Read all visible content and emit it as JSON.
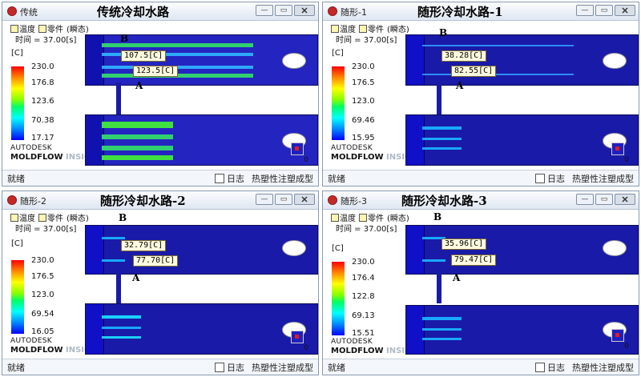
{
  "windows": [
    {
      "name": "传统",
      "heading": "传统冷却水路",
      "toolbar": {
        "item1": "温度",
        "item2": "零件",
        "mode": "(瞬态)"
      },
      "time_label": "时间 = 37.00[s]",
      "unit": "[C]",
      "legend": [
        "230.0",
        "176.8",
        "123.6",
        "70.38",
        "17.17"
      ],
      "probes": [
        "107.5[C]",
        "123.5[C]"
      ],
      "marker_b": "B",
      "marker_a": "A",
      "brand1": "AUTODESK",
      "brand2_main": "MOLDFLOW",
      "brand2_suffix": "INSIGHT",
      "axis_zero": "0",
      "status_ready": "就绪",
      "status_log": "日志",
      "status_mode": "热塑性注塑成型"
    },
    {
      "name": "随形-1",
      "heading": "随形冷却水路-1",
      "toolbar": {
        "item1": "温度",
        "item2": "零件",
        "mode": "(瞬态)"
      },
      "time_label": "时间 = 37.00[s]",
      "unit": "[C]",
      "legend": [
        "230.0",
        "176.5",
        "123.0",
        "69.46",
        "15.95"
      ],
      "probes": [
        "38.28[C]",
        "82.55[C]"
      ],
      "marker_b": "B",
      "marker_a": "A",
      "brand1": "AUTODESK",
      "brand2_main": "MOLDFLOW",
      "brand2_suffix": "INSIGHT",
      "axis_zero": "0",
      "status_ready": "就绪",
      "status_log": "日志",
      "status_mode": "热塑性注塑成型"
    },
    {
      "name": "随形-2",
      "heading": "随形冷却水路-2",
      "toolbar": {
        "item1": "温度",
        "item2": "零件",
        "mode": "(瞬态)"
      },
      "time_label": "时间 = 37.00[s]",
      "unit": "[C]",
      "legend": [
        "230.0",
        "176.5",
        "123.0",
        "69.54",
        "16.05"
      ],
      "probes": [
        "32.79[C]",
        "77.70[C]"
      ],
      "marker_b": "B",
      "marker_a": "A",
      "brand1": "AUTODESK",
      "brand2_main": "MOLDFLOW",
      "brand2_suffix": "INSIGHT",
      "axis_zero": "0",
      "status_ready": "就绪",
      "status_log": "日志",
      "status_mode": "热塑性注塑成型"
    },
    {
      "name": "随形-3",
      "heading": "随形冷却水路-3",
      "toolbar": {
        "item1": "温度",
        "item2": "零件",
        "mode": "(瞬态)"
      },
      "time_label": "时间 = 37.00[s]",
      "unit": "[C]",
      "legend": [
        "230.0",
        "176.4",
        "122.8",
        "69.13",
        "15.51"
      ],
      "probes": [
        "35.96[C]",
        "79.47[C]"
      ],
      "marker_b": "B",
      "marker_a": "A",
      "brand1": "AUTODESK",
      "brand2_main": "MOLDFLOW",
      "brand2_suffix": "INSIGHT",
      "axis_zero": "0",
      "status_ready": "就绪",
      "status_log": "日志",
      "status_mode": "热塑性注塑成型"
    }
  ],
  "colors": {
    "part_base": "#1a1aa8",
    "hot_band_traditional": "#3fe03f",
    "cool_band": "#19a8ff",
    "probe_box": "#fffbe0",
    "window_border": "#8a9bb3"
  },
  "icons": [
    "app-icon",
    "minimize-icon",
    "restore-icon",
    "close-icon",
    "log-icon",
    "axis-triad-icon"
  ]
}
